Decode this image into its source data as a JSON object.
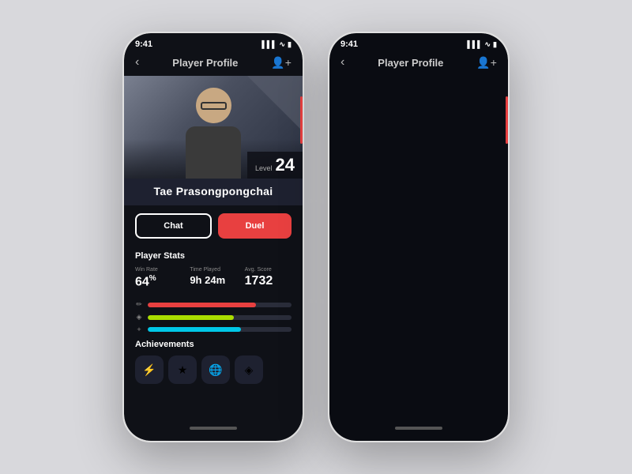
{
  "phone1": {
    "status": {
      "time": "9:41",
      "signal": "▌▌▌",
      "wifi": "WiFi",
      "battery": "🔋"
    },
    "header": {
      "back": "‹",
      "title": "Player Profile",
      "add_friend": "👤+"
    },
    "profile": {
      "level_label": "Level",
      "level": "24",
      "name": "Tae Prasongpongchai"
    },
    "buttons": {
      "chat": "Chat",
      "duel": "Duel"
    },
    "stats": {
      "section_title": "Player Stats",
      "items": [
        {
          "label": "Win Rate",
          "value": "64",
          "suffix": "%"
        },
        {
          "label": "Time Played",
          "value": "9h 24m",
          "suffix": ""
        },
        {
          "label": "Avg. Score",
          "value": "1732",
          "suffix": ""
        }
      ]
    },
    "bars": [
      {
        "icon": "✏",
        "color": "#e84040",
        "percent": 75
      },
      {
        "icon": "🛡",
        "color": "#aadd00",
        "percent": 60
      },
      {
        "icon": "+",
        "color": "#00c8e8",
        "percent": 65
      }
    ],
    "achievements": {
      "section_title": "Achievements",
      "badges": [
        "⚡",
        "★",
        "🌐",
        "◈"
      ]
    }
  },
  "phone2": {
    "status": {
      "time": "9:41",
      "signal": "▌▌▌",
      "wifi": "WiFi",
      "battery": "🔋"
    },
    "header": {
      "back": "‹",
      "title": "Player Profile",
      "add_friend": "👤+"
    }
  }
}
